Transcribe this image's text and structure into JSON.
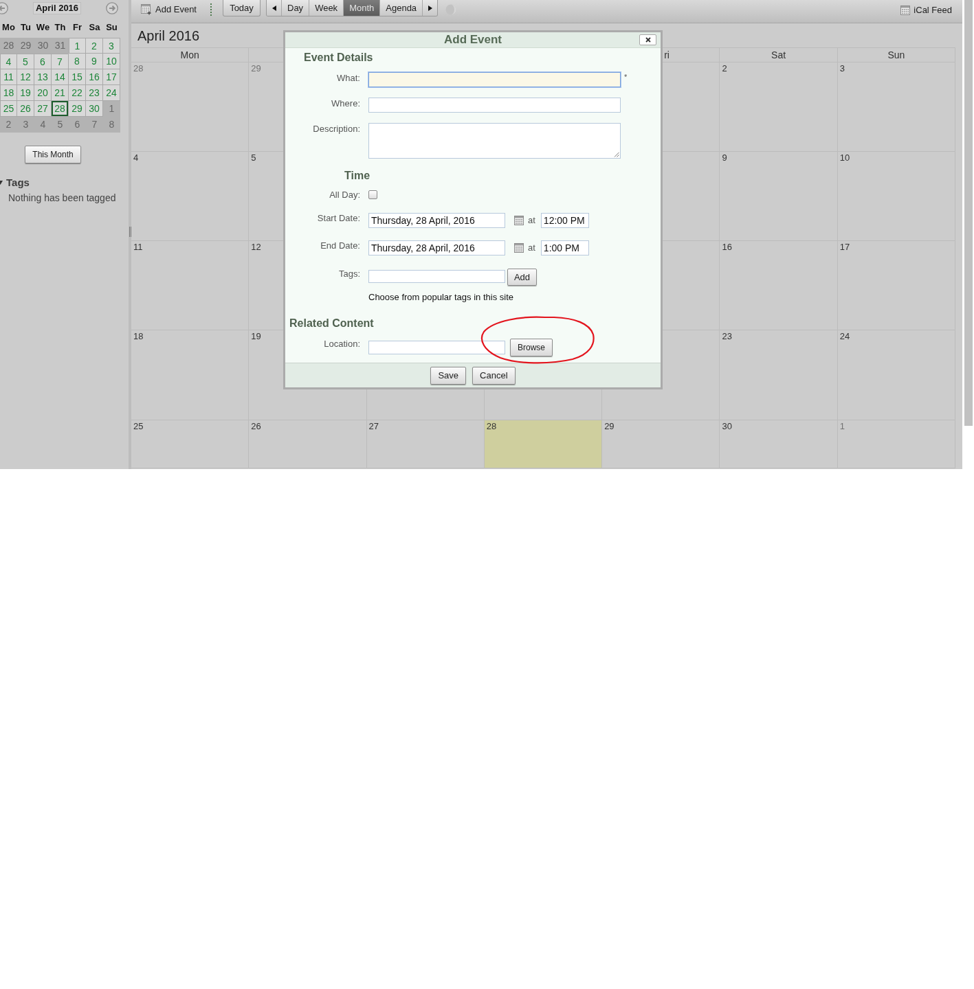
{
  "sidebar": {
    "mini_calendar": {
      "title": "April 2016",
      "weekdays": [
        "Mo",
        "Tu",
        "We",
        "Th",
        "Fr",
        "Sa",
        "Su"
      ],
      "weeks": [
        [
          {
            "day": "28",
            "outside_month": true,
            "today": false
          },
          {
            "day": "29",
            "outside_month": true,
            "today": false
          },
          {
            "day": "30",
            "outside_month": true,
            "today": false
          },
          {
            "day": "31",
            "outside_month": true,
            "today": false
          },
          {
            "day": "1",
            "outside_month": false,
            "today": false
          },
          {
            "day": "2",
            "outside_month": false,
            "today": false
          },
          {
            "day": "3",
            "outside_month": false,
            "today": false
          }
        ],
        [
          {
            "day": "4",
            "outside_month": false,
            "today": false
          },
          {
            "day": "5",
            "outside_month": false,
            "today": false
          },
          {
            "day": "6",
            "outside_month": false,
            "today": false
          },
          {
            "day": "7",
            "outside_month": false,
            "today": false
          },
          {
            "day": "8",
            "outside_month": false,
            "today": false
          },
          {
            "day": "9",
            "outside_month": false,
            "today": false
          },
          {
            "day": "10",
            "outside_month": false,
            "today": false
          }
        ],
        [
          {
            "day": "11",
            "outside_month": false,
            "today": false
          },
          {
            "day": "12",
            "outside_month": false,
            "today": false
          },
          {
            "day": "13",
            "outside_month": false,
            "today": false
          },
          {
            "day": "14",
            "outside_month": false,
            "today": false
          },
          {
            "day": "15",
            "outside_month": false,
            "today": false
          },
          {
            "day": "16",
            "outside_month": false,
            "today": false
          },
          {
            "day": "17",
            "outside_month": false,
            "today": false
          }
        ],
        [
          {
            "day": "18",
            "outside_month": false,
            "today": false
          },
          {
            "day": "19",
            "outside_month": false,
            "today": false
          },
          {
            "day": "20",
            "outside_month": false,
            "today": false
          },
          {
            "day": "21",
            "outside_month": false,
            "today": false
          },
          {
            "day": "22",
            "outside_month": false,
            "today": false
          },
          {
            "day": "23",
            "outside_month": false,
            "today": false
          },
          {
            "day": "24",
            "outside_month": false,
            "today": false
          }
        ],
        [
          {
            "day": "25",
            "outside_month": false,
            "today": false
          },
          {
            "day": "26",
            "outside_month": false,
            "today": false
          },
          {
            "day": "27",
            "outside_month": false,
            "today": false
          },
          {
            "day": "28",
            "outside_month": false,
            "today": true
          },
          {
            "day": "29",
            "outside_month": false,
            "today": false
          },
          {
            "day": "30",
            "outside_month": false,
            "today": false
          },
          {
            "day": "1",
            "outside_month": true,
            "today": false
          }
        ],
        [
          {
            "day": "2",
            "outside_month": true,
            "today": false
          },
          {
            "day": "3",
            "outside_month": true,
            "today": false
          },
          {
            "day": "4",
            "outside_month": true,
            "today": false
          },
          {
            "day": "5",
            "outside_month": true,
            "today": false
          },
          {
            "day": "6",
            "outside_month": true,
            "today": false
          },
          {
            "day": "7",
            "outside_month": true,
            "today": false
          },
          {
            "day": "8",
            "outside_month": true,
            "today": false
          }
        ]
      ]
    },
    "this_month": "This Month",
    "tags": {
      "title": "Tags",
      "expanded": true,
      "empty_text": "Nothing has been tagged"
    }
  },
  "toolbar": {
    "add_event": "Add Event",
    "today": "Today",
    "views": [
      {
        "label": "Day",
        "selected": false
      },
      {
        "label": "Week",
        "selected": false
      },
      {
        "label": "Month",
        "selected": true
      },
      {
        "label": "Agenda",
        "selected": false
      }
    ],
    "ical_feed": "iCal Feed"
  },
  "calendar": {
    "title": "April 2016",
    "columns_left": [
      {
        "label": "Mon",
        "kind": "full"
      }
    ],
    "columns_right": [
      {
        "label": "ri",
        "kind": "partial"
      },
      {
        "label": "Sat",
        "kind": "full"
      },
      {
        "label": "Sun",
        "kind": "full"
      }
    ],
    "weeks": [
      {
        "days_left": [
          {
            "day": "28",
            "outside_month": true,
            "today": false
          },
          {
            "day": "29",
            "outside_month": true,
            "today": false
          }
        ],
        "days_right": [
          {
            "day": "2",
            "outside_month": false,
            "today": false
          },
          {
            "day": "3",
            "outside_month": false,
            "today": false
          }
        ]
      },
      {
        "days_left": [
          {
            "day": "4",
            "outside_month": false,
            "today": false
          },
          {
            "day": "5",
            "outside_month": false,
            "today": false
          }
        ],
        "days_right": [
          {
            "day": "9",
            "outside_month": false,
            "today": false
          },
          {
            "day": "10",
            "outside_month": false,
            "today": false
          }
        ]
      },
      {
        "days_left": [
          {
            "day": "11",
            "outside_month": false,
            "today": false
          },
          {
            "day": "12",
            "outside_month": false,
            "today": false
          }
        ],
        "days_right": [
          {
            "day": "16",
            "outside_month": false,
            "today": false
          },
          {
            "day": "17",
            "outside_month": false,
            "today": false
          }
        ]
      },
      {
        "days_left": [
          {
            "day": "18",
            "outside_month": false,
            "today": false
          },
          {
            "day": "19",
            "outside_month": false,
            "today": false
          }
        ],
        "days_right": [
          {
            "day": "23",
            "outside_month": false,
            "today": false
          },
          {
            "day": "24",
            "outside_month": false,
            "today": false
          }
        ]
      },
      {
        "days_left": [
          {
            "day": "25",
            "outside_month": false,
            "today": false
          },
          {
            "day": "26",
            "outside_month": false,
            "today": false
          },
          {
            "day": "27",
            "outside_month": false,
            "today": false
          },
          {
            "day": "28",
            "outside_month": false,
            "today": true
          },
          {
            "day": "29",
            "outside_month": false,
            "today": false
          },
          {
            "day": "30",
            "outside_month": false,
            "today": false
          },
          {
            "day": "1",
            "outside_month": true,
            "today": false
          }
        ]
      }
    ]
  },
  "dialog": {
    "title": "Add Event",
    "sections": [
      {
        "heading": "Event Details",
        "fields": [
          {
            "kind": "text",
            "label": "What:",
            "focused": true,
            "required_mark": "*"
          },
          {
            "kind": "text",
            "label": "Where:",
            "focused": false
          },
          {
            "kind": "textarea",
            "label": "Description:",
            "focused": false
          }
        ]
      },
      {
        "heading": "Time",
        "fields": [
          {
            "kind": "checkbox",
            "label": "All Day:",
            "checked": false
          },
          {
            "kind": "datetime",
            "label": "Start Date:",
            "date": "Thursday, 28 April, 2016",
            "at": "at",
            "time": "12:00 PM"
          },
          {
            "kind": "datetime",
            "label": "End Date:",
            "date": "Thursday, 28 April, 2016",
            "at": "at",
            "time": "1:00 PM"
          },
          {
            "kind": "tags",
            "label": "Tags:",
            "button": "Add",
            "hint": "Choose from popular tags in this site"
          }
        ]
      },
      {
        "heading": "Related Content",
        "fields": [
          {
            "kind": "browse",
            "label": "Location:",
            "button": "Browse"
          }
        ]
      }
    ],
    "buttons": [
      "Save",
      "Cancel"
    ]
  }
}
